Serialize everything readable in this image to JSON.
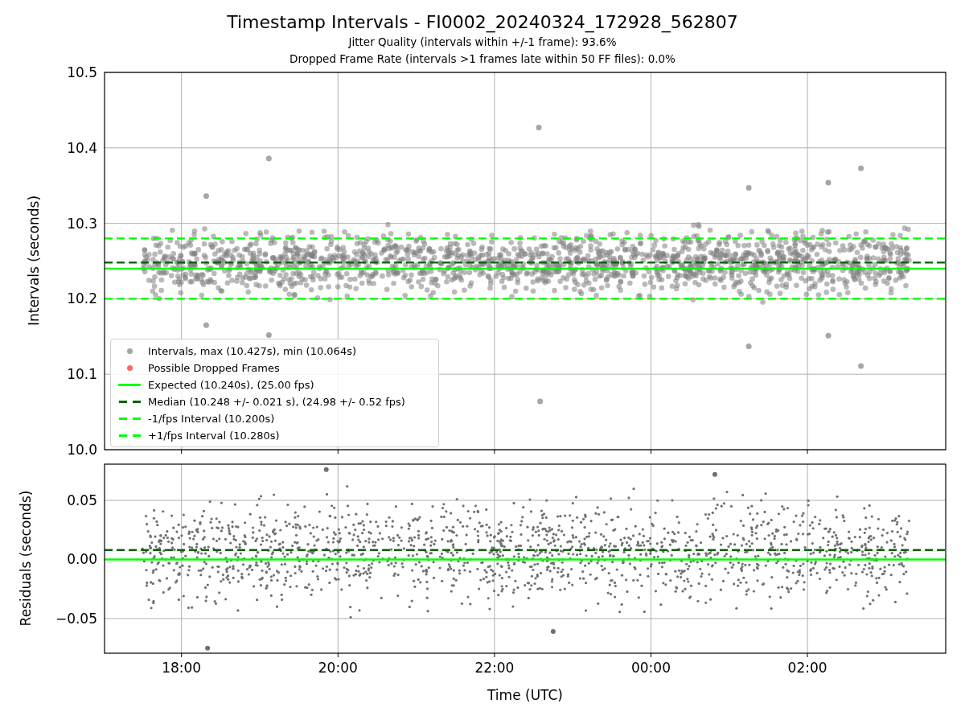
{
  "title": "Timestamp Intervals - FI0002_20240324_172928_562807",
  "subtitle_lines": [
    "Jitter Quality (intervals within +/-1 frame): 93.6%",
    "Dropped Frame Rate (intervals >1 frames late within 50 FF files): 0.0%"
  ],
  "intervals_chart": {
    "chart_data": {
      "type": "scatter",
      "ylabel": "Intervals (seconds)",
      "xlim": [
        "2024-03-24T17:01",
        "2024-03-25T03:46"
      ],
      "ylim": [
        10.0,
        10.5
      ],
      "grid": true,
      "yticks": [
        {
          "value": 10.0,
          "label": "10.0"
        },
        {
          "value": 10.1,
          "label": "10.1"
        },
        {
          "value": 10.2,
          "label": "10.2"
        },
        {
          "value": 10.3,
          "label": "10.3"
        },
        {
          "value": 10.4,
          "label": "10.4"
        },
        {
          "value": 10.5,
          "label": "10.5"
        }
      ],
      "series": [
        {
          "color": "#a6a6a6",
          "x": [
            "2024-03-24T19:07",
            "2024-03-24T18:19",
            "2024-03-24T22:34",
            "2024-03-24T22:35",
            "2024-03-25T01:15",
            "2024-03-25T01:15",
            "2024-03-25T02:16",
            "2024-03-25T02:16",
            "2024-03-25T02:41",
            "2024-03-25T02:41",
            "2024-03-24T18:19",
            "2024-03-24T19:07"
          ],
          "values": [
            10.386,
            10.336,
            10.427,
            10.064,
            10.347,
            10.137,
            10.354,
            10.151,
            10.373,
            10.111,
            10.165,
            10.152
          ]
        }
      ],
      "ref_lines": [
        {
          "axis": "y",
          "value": 10.24,
          "color": "#00ff00"
        },
        {
          "axis": "y",
          "value": 10.248,
          "color": "#006400"
        },
        {
          "axis": "y",
          "value": 10.2,
          "color": "#00ff00"
        },
        {
          "axis": "y",
          "value": 10.28,
          "color": "#00ff00"
        }
      ]
    },
    "legend": [
      {
        "kind": "marker",
        "label": "Intervals, max (10.427s), min (10.064s)",
        "color": "#a6a6a6"
      },
      {
        "kind": "marker",
        "label": "Possible Dropped Frames",
        "color": "#ff6666"
      },
      {
        "kind": "solid",
        "label": "Expected (10.240s), (25.00 fps)",
        "color": "#00ff00"
      },
      {
        "kind": "dashed",
        "label": "Median (10.248 +/- 0.021 s), (24.98 +/- 0.52 fps)",
        "color": "#006400"
      },
      {
        "kind": "dashed",
        "label": "-1/fps Interval (10.200s)",
        "color": "#00ff00"
      },
      {
        "kind": "dashed",
        "label": "+1/fps Interval (10.280s)",
        "color": "#00ff00"
      }
    ]
  },
  "residuals_chart": {
    "chart_data": {
      "type": "scatter",
      "xlabel": "Time (UTC)",
      "ylabel": "Residuals (seconds)",
      "xlim": [
        "2024-03-24T17:01",
        "2024-03-25T03:46"
      ],
      "ylim": [
        -0.0793,
        0.0806
      ],
      "grid": true,
      "xticks": [
        {
          "value": "2024-03-24T18:00",
          "label": "18:00"
        },
        {
          "value": "2024-03-24T20:00",
          "label": "20:00"
        },
        {
          "value": "2024-03-24T22:00",
          "label": "22:00"
        },
        {
          "value": "2024-03-25T00:00",
          "label": "00:00"
        },
        {
          "value": "2024-03-25T02:00",
          "label": "02:00"
        }
      ],
      "yticks": [
        {
          "value": 0.05,
          "label": "0.05"
        },
        {
          "value": 0.0,
          "label": "0.00"
        },
        {
          "value": -0.05,
          "label": "−0.05"
        }
      ],
      "series": [
        {
          "color": "#707070",
          "x": [
            "2024-03-24T18:20",
            "2024-03-24T19:51",
            "2024-03-25T00:49",
            "2024-03-24T22:45"
          ],
          "values": [
            -0.075,
            0.076,
            0.072,
            -0.061
          ]
        }
      ],
      "ref_lines": [
        {
          "axis": "y",
          "value": 0.0,
          "color": "#00ff00"
        },
        {
          "axis": "y",
          "value": 0.008,
          "color": "#006400"
        }
      ]
    }
  }
}
